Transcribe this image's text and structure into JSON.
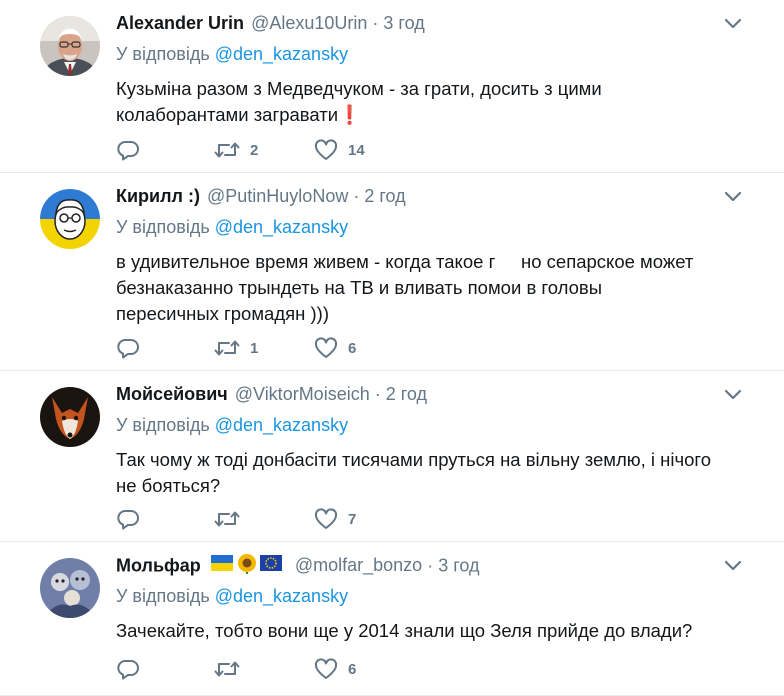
{
  "tweets": [
    {
      "name": "Alexander Urin",
      "handle": "@Alexu10Urin",
      "separator": "·",
      "time": "3 год",
      "reply_prefix": "У відповідь",
      "reply_mention": "@den_kazansky",
      "text": "Кузьміна разом з Медведчуком - за грати, досить з цими колаборантами загравати❗",
      "retweets": "2",
      "likes": "14",
      "avatar": "older-man-glasses"
    },
    {
      "name": "Кирилл :)",
      "handle": "@PutinHuyloNow",
      "separator": "·",
      "time": "2 год",
      "reply_prefix": "У відповідь",
      "reply_mention": "@den_kazansky",
      "text": "в удивительное время живем - когда такое г     но сепарское может безнаказанно трындеть на ТВ и вливать помои в головы пересичных громадян )))",
      "retweets": "1",
      "likes": "6",
      "avatar": "cartoon-face-blue-yellow"
    },
    {
      "name": "Мойсейович",
      "handle": "@ViktorMoiseich",
      "separator": "·",
      "time": "2 год",
      "reply_prefix": "У відповідь",
      "reply_mention": "@den_kazansky",
      "text": "Так чому ж тоді донбасіти тисячами пруться на вільну землю, і нічого не бояться?",
      "retweets": "",
      "likes": "7",
      "avatar": "fox"
    },
    {
      "name": "Мольфар",
      "handle": "@molfar_bonzo",
      "separator": "·",
      "time": "3 год",
      "reply_prefix": "У відповідь",
      "reply_mention": "@den_kazansky",
      "text": "Зачекайте, тобто вони ще у 2014 знали що Зеля прийде до влади?",
      "retweets": "",
      "likes": "6",
      "avatar": "illustrated-group",
      "flag_icons": [
        "ukraine-flag-icon",
        "sunflower-icon",
        "eu-flag-icon"
      ]
    }
  ],
  "colors": {
    "text": "#14171a",
    "muted": "#657786",
    "link": "#1b95e0",
    "divider": "#e6ecf0"
  },
  "icons": {
    "reply": "reply-icon",
    "retweet": "retweet-icon",
    "like": "heart-icon",
    "more": "chevron-down-icon"
  }
}
